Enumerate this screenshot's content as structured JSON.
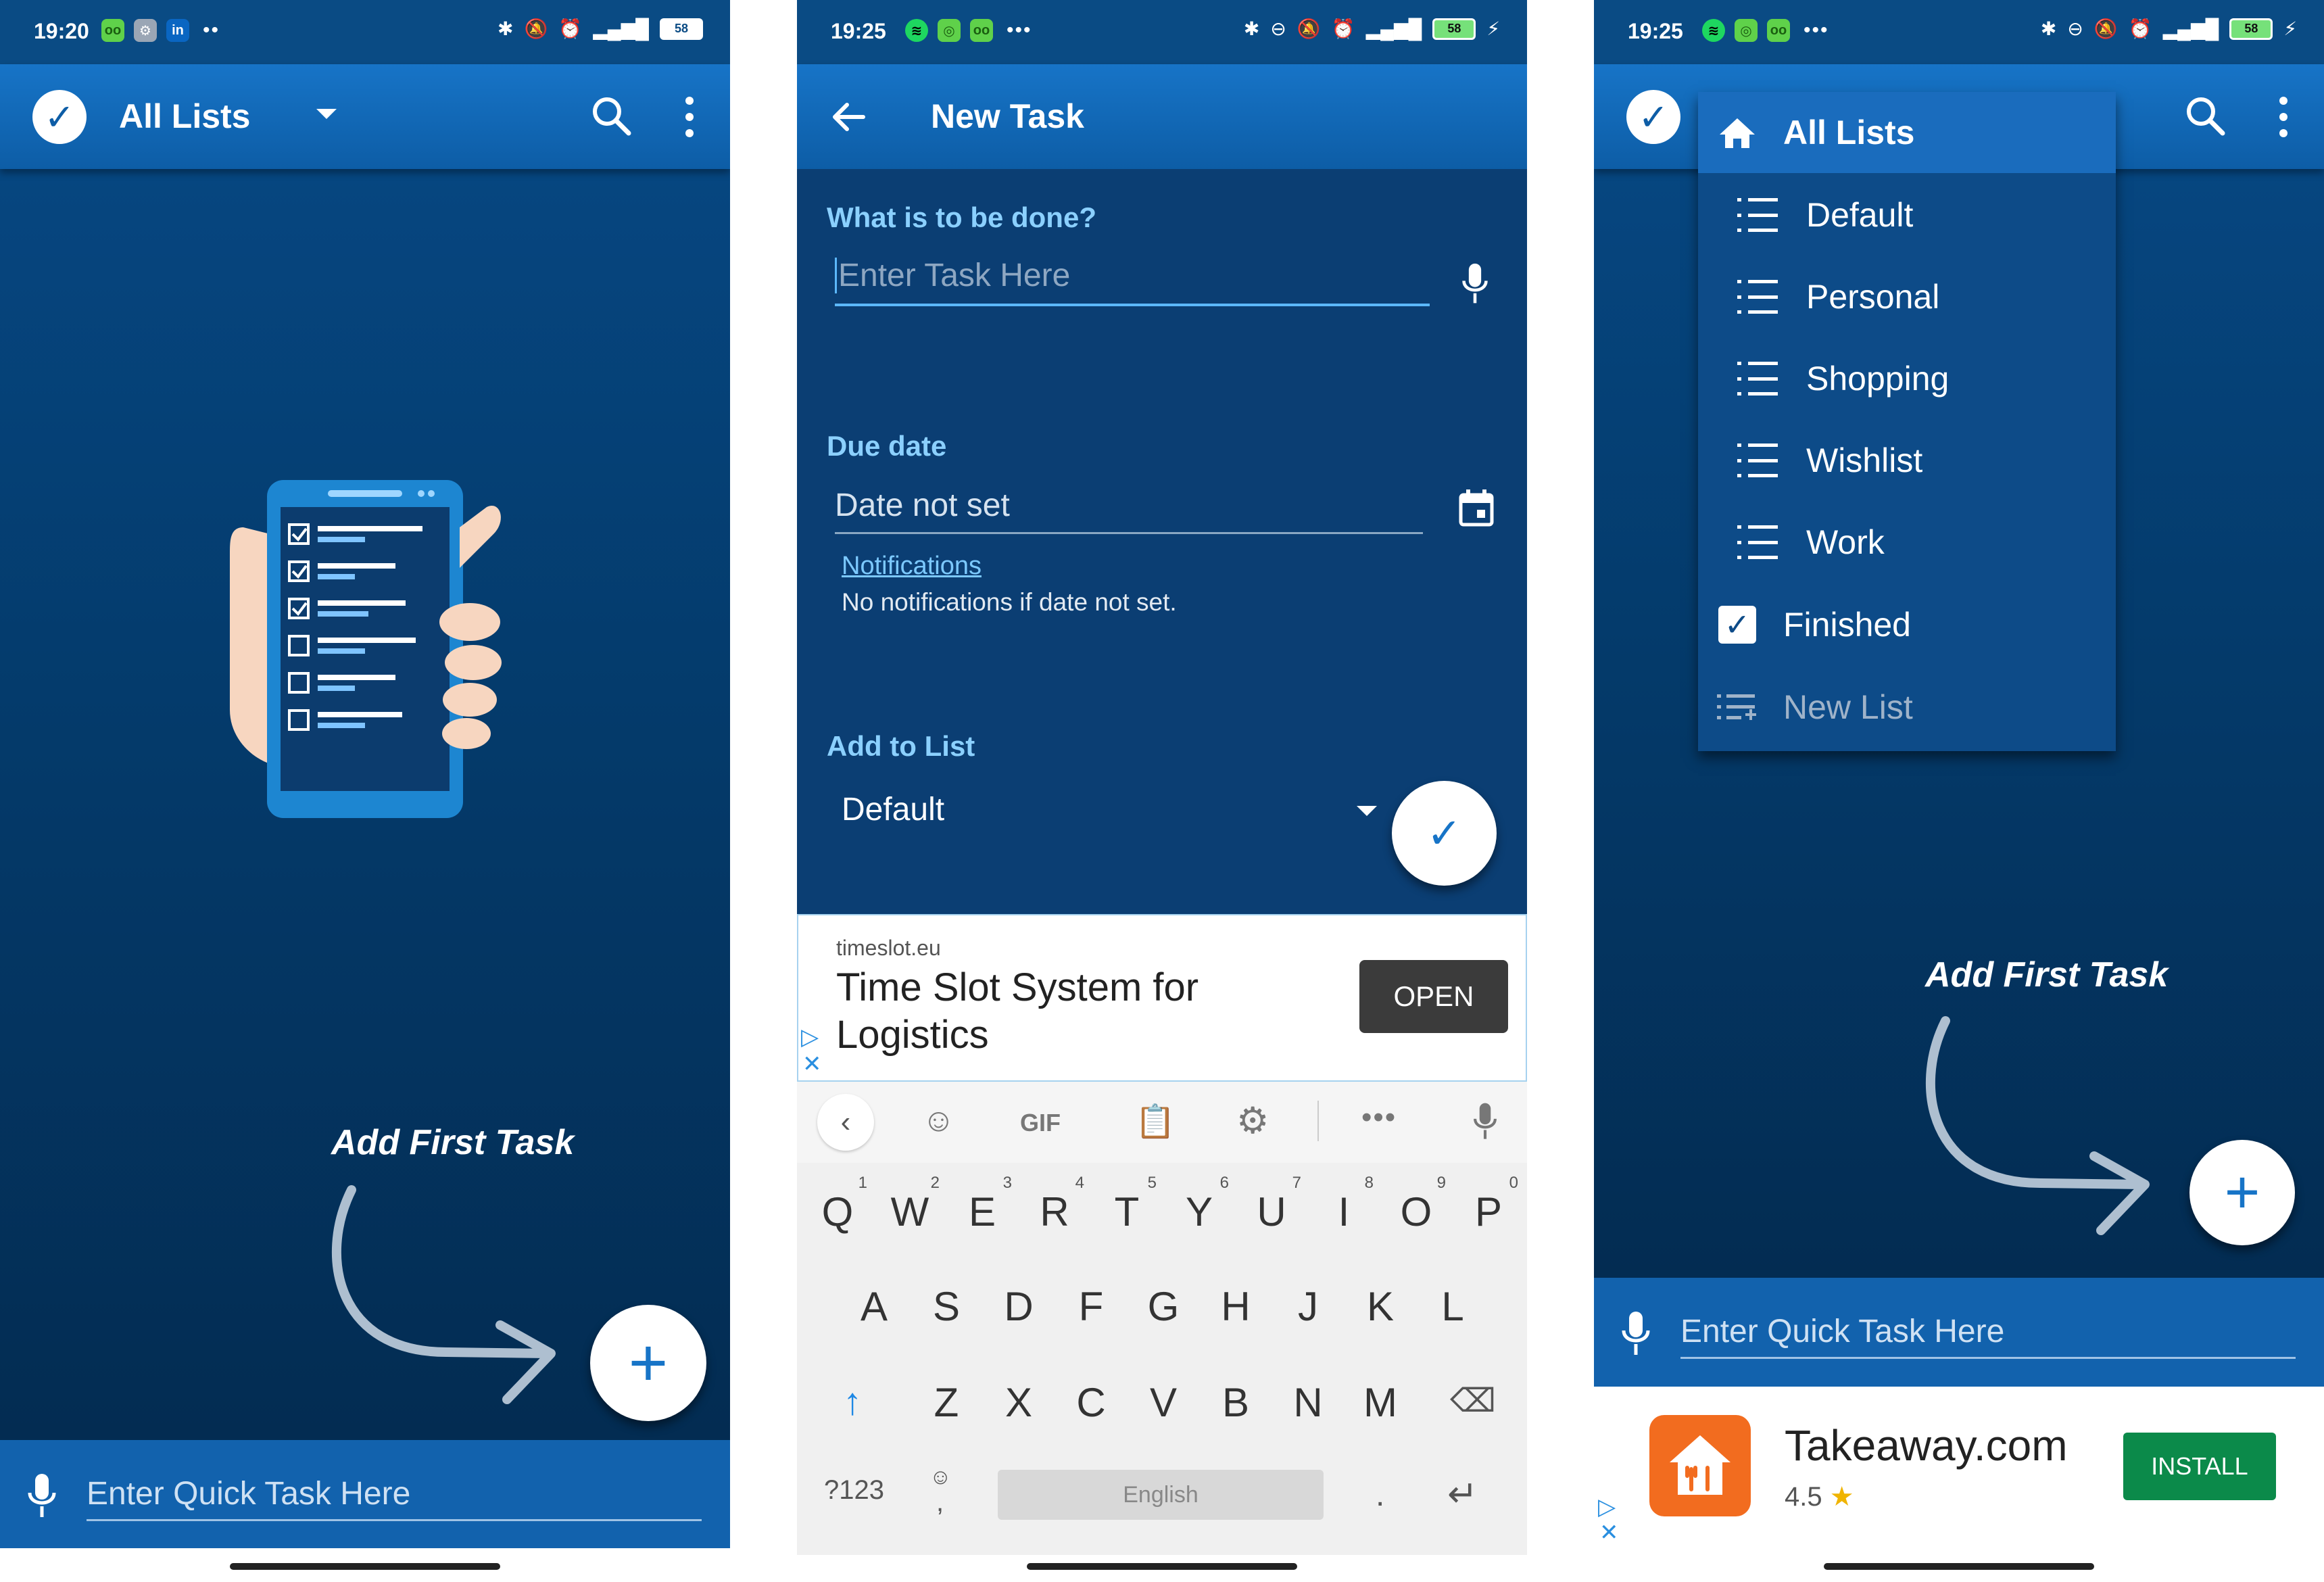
{
  "panel1": {
    "time": "19:20",
    "battery": "58",
    "title": "All Lists",
    "hint": "Add First Task",
    "quick_placeholder": "Enter Quick Task Here",
    "fab_label": "+"
  },
  "panel2": {
    "time": "19:25",
    "battery": "58",
    "title": "New Task",
    "task_label": "What is to be done?",
    "task_placeholder": "Enter Task Here",
    "due_label": "Due date",
    "due_value": "Date not set",
    "notifications_link": "Notifications",
    "notifications_note": "No notifications if date not set.",
    "list_label": "Add to List",
    "list_value": "Default",
    "ad": {
      "domain": "timeslot.eu",
      "headline_line1": "Time Slot System for",
      "headline_line2": "Logistics",
      "button": "OPEN"
    },
    "keyboard": {
      "row1": [
        "Q",
        "W",
        "E",
        "R",
        "T",
        "Y",
        "U",
        "I",
        "O",
        "P"
      ],
      "row1_nums": [
        "1",
        "2",
        "3",
        "4",
        "5",
        "6",
        "7",
        "8",
        "9",
        "0"
      ],
      "row2": [
        "A",
        "S",
        "D",
        "F",
        "G",
        "H",
        "J",
        "K",
        "L"
      ],
      "row3": [
        "Z",
        "X",
        "C",
        "V",
        "B",
        "N",
        "M"
      ],
      "symbols_key": "?123",
      "comma": ",",
      "period": ".",
      "space_label": "English",
      "gif": "GIF"
    }
  },
  "panel3": {
    "time": "19:25",
    "battery": "58",
    "menu": {
      "header": "All Lists",
      "items": [
        "Default",
        "Personal",
        "Shopping",
        "Wishlist",
        "Work"
      ],
      "finished": "Finished",
      "new_list": "New List"
    },
    "hint": "Add First Task",
    "fab_label": "+",
    "quick_placeholder": "Enter Quick Task Here",
    "ad": {
      "app_name": "Takeaway.com",
      "rating": "4.5",
      "star": "★",
      "button": "INSTALL"
    }
  },
  "colors": {
    "toolbar": "#1774c7",
    "body": "#064680",
    "quickbar": "#1262ad",
    "accent_label": "#8bd0ff",
    "install": "#0b8a4a"
  }
}
